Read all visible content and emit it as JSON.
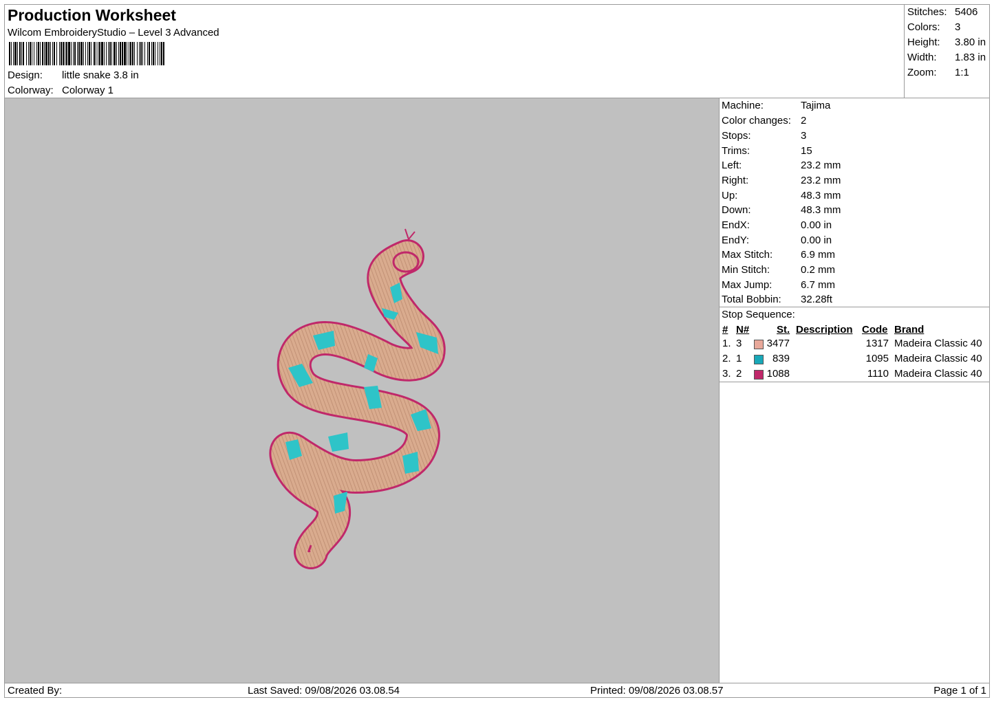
{
  "header": {
    "title": "Production Worksheet",
    "subtitle": "Wilcom EmbroideryStudio – Level 3 Advanced",
    "design_label": "Design:",
    "design_value": "little snake 3.8 in",
    "colorway_label": "Colorway:",
    "colorway_value": "Colorway 1"
  },
  "summary": [
    {
      "label": "Stitches:",
      "value": "5406"
    },
    {
      "label": "Colors:",
      "value": "3"
    },
    {
      "label": "Height:",
      "value": "3.80 in"
    },
    {
      "label": "Width:",
      "value": "1.83 in"
    },
    {
      "label": "Zoom:",
      "value": "1:1"
    }
  ],
  "machine": [
    {
      "label": "Machine:",
      "value": "Tajima"
    },
    {
      "label": "Color changes:",
      "value": "2"
    },
    {
      "label": "Stops:",
      "value": "3"
    },
    {
      "label": "Trims:",
      "value": "15"
    },
    {
      "label": "Left:",
      "value": "23.2 mm"
    },
    {
      "label": "Right:",
      "value": "23.2 mm"
    },
    {
      "label": "Up:",
      "value": "48.3 mm"
    },
    {
      "label": "Down:",
      "value": "48.3 mm"
    },
    {
      "label": "EndX:",
      "value": "0.00 in"
    },
    {
      "label": "EndY:",
      "value": "0.00 in"
    },
    {
      "label": "Max Stitch:",
      "value": "6.9 mm"
    },
    {
      "label": "Min Stitch:",
      "value": "0.2 mm"
    },
    {
      "label": "Max Jump:",
      "value": "6.7 mm"
    },
    {
      "label": "Total Bobbin:",
      "value": "32.28ft"
    }
  ],
  "stop_sequence": {
    "label": "Stop Sequence:",
    "headers": {
      "num": "#",
      "n": "N#",
      "st": "St.",
      "description": "Description",
      "code": "Code",
      "brand": "Brand"
    },
    "rows": [
      {
        "num": "1.",
        "n": "3",
        "color": "#e8a89a",
        "st": "3477",
        "description": "",
        "code": "1317",
        "brand": "Madeira Classic 40"
      },
      {
        "num": "2.",
        "n": "1",
        "color": "#18a8b8",
        "st": "839",
        "description": "",
        "code": "1095",
        "brand": "Madeira Classic 40"
      },
      {
        "num": "3.",
        "n": "2",
        "color": "#c0286a",
        "st": "1088",
        "description": "",
        "code": "1110",
        "brand": "Madeira Classic 40"
      }
    ]
  },
  "design_colors": {
    "background": "#c0c0c0",
    "body": "#d9ab8e",
    "stripes": "#2ec4c8",
    "outline": "#c0286a"
  },
  "footer": {
    "created_by": "Created By:",
    "last_saved": "Last Saved: 09/08/2026 03.08.54",
    "printed": "Printed: 09/08/2026 03.08.57",
    "page": "Page 1 of 1"
  }
}
